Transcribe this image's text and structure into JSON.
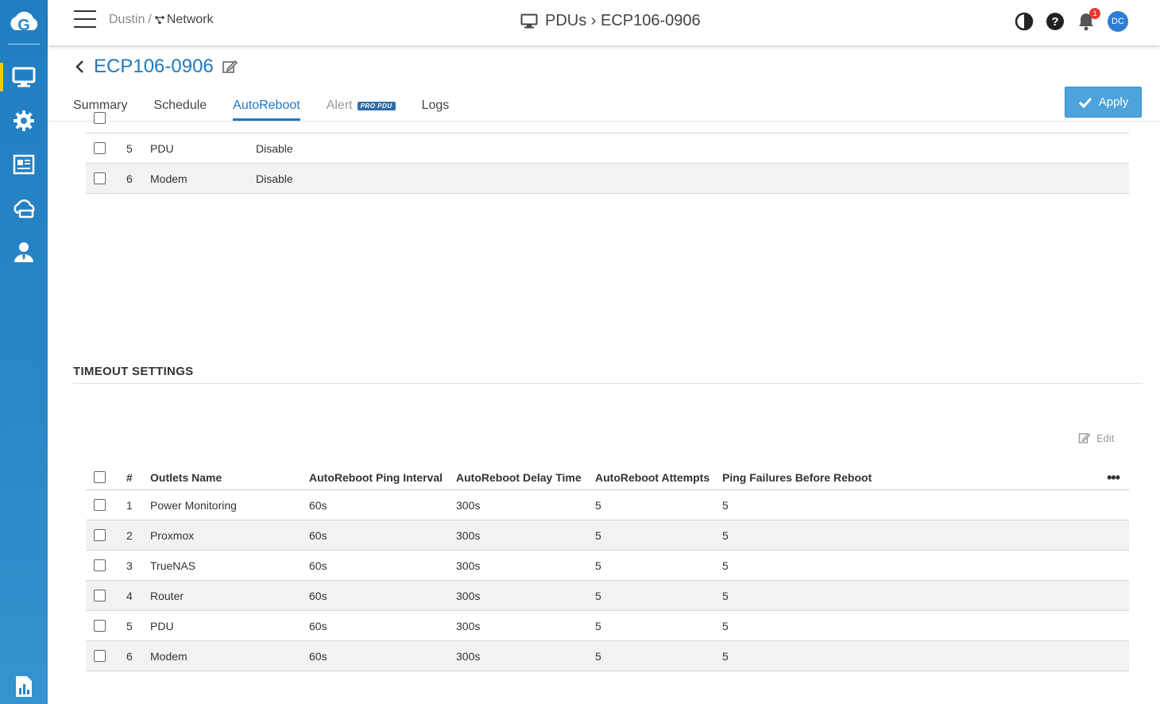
{
  "header": {
    "breadcrumb_user": "Dustin",
    "breadcrumb_sep": "/",
    "breadcrumb_network": "Network",
    "page_title": "PDUs › ECP106-0906",
    "notifications_count": "1",
    "avatar_initials": "DC"
  },
  "device": {
    "name": "ECP106-0906"
  },
  "tabs": [
    {
      "label": "Summary"
    },
    {
      "label": "Schedule"
    },
    {
      "label": "AutoReboot"
    },
    {
      "label": "Alert",
      "badge": "PRO PDU"
    },
    {
      "label": "Logs"
    }
  ],
  "apply_label": "Apply",
  "top_table": {
    "rows": [
      {
        "num": "5",
        "name": "PDU",
        "status": "Disable"
      },
      {
        "num": "6",
        "name": "Modem",
        "status": "Disable"
      }
    ]
  },
  "timeout": {
    "title": "TIMEOUT SETTINGS",
    "edit_label": "Edit",
    "more_label": "•••",
    "columns": [
      "#",
      "Outlets Name",
      "AutoReboot Ping Interval",
      "AutoReboot Delay Time",
      "AutoReboot Attempts",
      "Ping Failures Before Reboot"
    ],
    "rows": [
      {
        "num": "1",
        "name": "Power Monitoring",
        "interval": "60s",
        "delay": "300s",
        "attempts": "5",
        "failures": "5"
      },
      {
        "num": "2",
        "name": "Proxmox",
        "interval": "60s",
        "delay": "300s",
        "attempts": "5",
        "failures": "5"
      },
      {
        "num": "3",
        "name": "TrueNAS",
        "interval": "60s",
        "delay": "300s",
        "attempts": "5",
        "failures": "5"
      },
      {
        "num": "4",
        "name": "Router",
        "interval": "60s",
        "delay": "300s",
        "attempts": "5",
        "failures": "5"
      },
      {
        "num": "5",
        "name": "PDU",
        "interval": "60s",
        "delay": "300s",
        "attempts": "5",
        "failures": "5"
      },
      {
        "num": "6",
        "name": "Modem",
        "interval": "60s",
        "delay": "300s",
        "attempts": "5",
        "failures": "5"
      }
    ]
  },
  "colors": {
    "sidebar": "#2a86c6",
    "accent": "#1f78c1",
    "apply": "#4da3db",
    "active_marker": "#f5c518"
  },
  "icons": {
    "sidebar": [
      "monitor-icon",
      "gear-icon",
      "news-icon",
      "cloud-sync-icon",
      "user-admin-icon",
      "report-icon"
    ]
  }
}
